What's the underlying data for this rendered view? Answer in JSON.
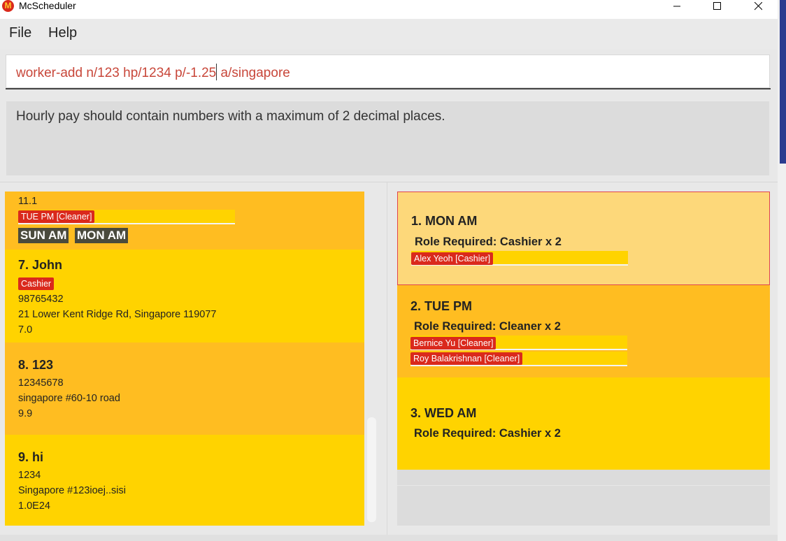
{
  "window": {
    "title": "McScheduler",
    "logo_letter": "M",
    "minimize": "—",
    "maximize": "☐",
    "close": "✕"
  },
  "menu": {
    "file": "File",
    "help": "Help"
  },
  "command": {
    "before_caret": "worker-add n/123 hp/1234 p/-1.25",
    "after_caret": " a/singapore"
  },
  "result": {
    "message": "Hourly pay should contain numbers with a maximum of 2 decimal places."
  },
  "workers": {
    "partial": {
      "pay": "11.1",
      "shift_tag": "TUE PM [Cleaner]",
      "unavailable": [
        "SUN AM",
        "MON AM"
      ]
    },
    "items": [
      {
        "title": "7.  John",
        "role": "Cashier",
        "phone": "98765432",
        "address": "21 Lower Kent Ridge Rd, Singapore 119077",
        "pay": "7.0"
      },
      {
        "title": "8.  123",
        "phone": "12345678",
        "address": "singapore #60-10 road",
        "pay": "9.9"
      },
      {
        "title": "9.  hi",
        "phone": "1234",
        "address": "Singapore #123ioej..sisi",
        "pay": "1.0E24"
      }
    ]
  },
  "shifts": [
    {
      "title": "1.  MON AM",
      "role": "Role Required: Cashier x 2",
      "assigned": [
        "Alex Yeoh [Cashier]"
      ]
    },
    {
      "title": "2.  TUE PM",
      "role": "Role Required: Cleaner x 2",
      "assigned": [
        "Bernice Yu [Cleaner]",
        "Roy Balakrishnan [Cleaner]"
      ]
    },
    {
      "title": "3.  WED AM",
      "role": "Role Required: Cashier x 2",
      "assigned": []
    }
  ],
  "colors": {
    "yellow": "#ffd300",
    "orange": "#ffbd21",
    "tag_red": "#da291c",
    "selected": "#fdd87a"
  }
}
